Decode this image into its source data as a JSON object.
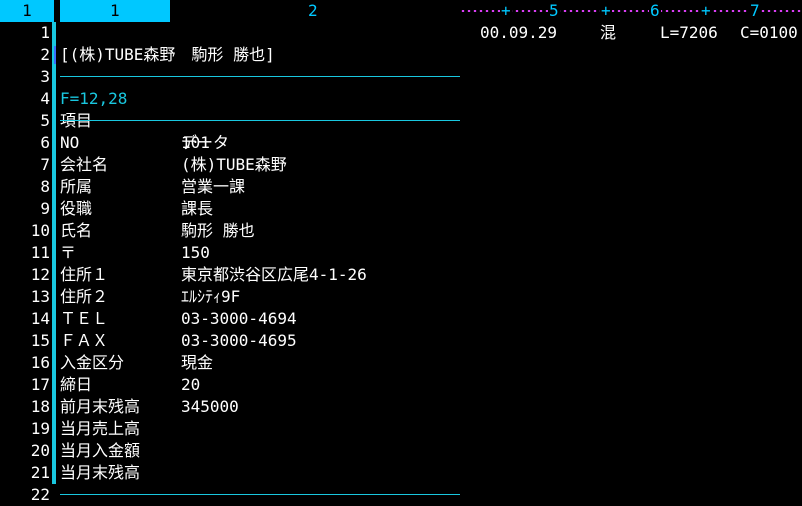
{
  "ruler": {
    "row_label": "1",
    "col1": "1",
    "col2": "2",
    "marks": [
      "+",
      "5",
      "+",
      "6",
      "+",
      "7"
    ]
  },
  "line_numbers": [
    "1",
    "2",
    "3",
    "4",
    "5",
    "6",
    "7",
    "8",
    "9",
    "10",
    "11",
    "12",
    "13",
    "14",
    "15",
    "16",
    "17",
    "18",
    "19",
    "20",
    "21",
    "22"
  ],
  "header": {
    "title_line": "[(株)TUBE森野　駒形 勝也]",
    "format_line": "F=12,28",
    "date": "00.09.29",
    "mode": "混",
    "line_info": "L=7206",
    "col_info": "C=0100"
  },
  "table": {
    "header_label": "項目",
    "header_value": "データ",
    "rows": [
      {
        "label": "NO",
        "value": "101"
      },
      {
        "label": "会社名",
        "value": "(株)TUBE森野"
      },
      {
        "label": "所属",
        "value": "営業一課"
      },
      {
        "label": "役職",
        "value": "課長"
      },
      {
        "label": "氏名",
        "value": "駒形 勝也"
      },
      {
        "label": "〒",
        "value": "150"
      },
      {
        "label": "住所１",
        "value": "東京都渋谷区広尾4-1-26"
      },
      {
        "label": "住所２",
        "value": "ｴﾙｼﾃｨ9F"
      },
      {
        "label": "ＴＥＬ",
        "value": "03-3000-4694"
      },
      {
        "label": "ＦＡＸ",
        "value": "03-3000-4695"
      },
      {
        "label": "入金区分",
        "value": "現金"
      },
      {
        "label": "締日",
        "value": "20"
      },
      {
        "label": "前月末残高",
        "value": "345000"
      },
      {
        "label": "当月売上高",
        "value": ""
      },
      {
        "label": "当月入金額",
        "value": ""
      },
      {
        "label": "当月末残高",
        "value": ""
      }
    ]
  }
}
